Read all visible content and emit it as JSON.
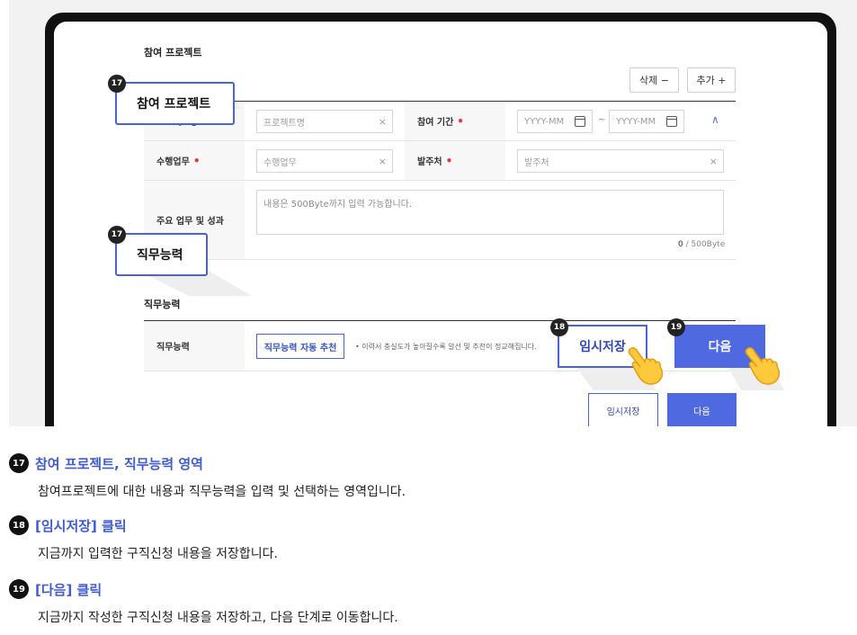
{
  "project_section": {
    "title": "참여 프로젝트",
    "delete_label": "삭제 −",
    "add_label": "추가 +",
    "project_name_label": "프로젝트명",
    "project_name_placeholder": "프로젝트명",
    "period_label": "참여 기간",
    "start_placeholder": "YYYY-MM",
    "end_placeholder": "YYYY-MM",
    "period_separator": "~",
    "duty_label": "수행업무",
    "duty_placeholder": "수행업무",
    "client_label": "발주처",
    "client_placeholder": "발주처",
    "main_duty_label": "주요 업무 및 성과",
    "main_duty_placeholder": "내용은 500Byte까지 입력 가능합니다.",
    "counter_current": "0",
    "counter_max": " / 500Byte",
    "required_mark": "•",
    "clear_mark": "×",
    "collapse_mark": "∧"
  },
  "skill_section": {
    "title": "직무능력",
    "row_label": "직무능력",
    "recommend_button": "직무능력 자동 추천",
    "hint": "• 이력서 충실도가 높아질수록 알선 및 추천이 정교해집니다."
  },
  "actions": {
    "save_label": "임시저장",
    "next_label": "다음"
  },
  "callouts": {
    "badge_17": "17",
    "badge_18": "18",
    "badge_19": "19",
    "project_callout": "참여 프로젝트",
    "skill_callout": "직무능력",
    "save_callout": "임시저장",
    "next_callout": "다음"
  },
  "descriptions": [
    {
      "num": "17",
      "title": "참여 프로젝트, 직무능력 영역",
      "text": "참여프로젝트에 대한 내용과 직무능력을 입력 및 선택하는 영역입니다."
    },
    {
      "num": "18",
      "title": "[임시저장] 클릭",
      "text": "지금까지 입력한 구직신청 내용을 저장합니다."
    },
    {
      "num": "19",
      "title": "[다음] 클릭",
      "text": "지금까지 작성한 구직신청 내용을 저장하고, 다음 단계로 이동합니다."
    }
  ],
  "colors": {
    "accent": "#4f6ae0",
    "required": "#e53935",
    "device_frame": "#111111"
  },
  "icons": [
    "calendar-icon",
    "clear-icon",
    "chevron-up-icon",
    "pointing-hand-icon"
  ]
}
